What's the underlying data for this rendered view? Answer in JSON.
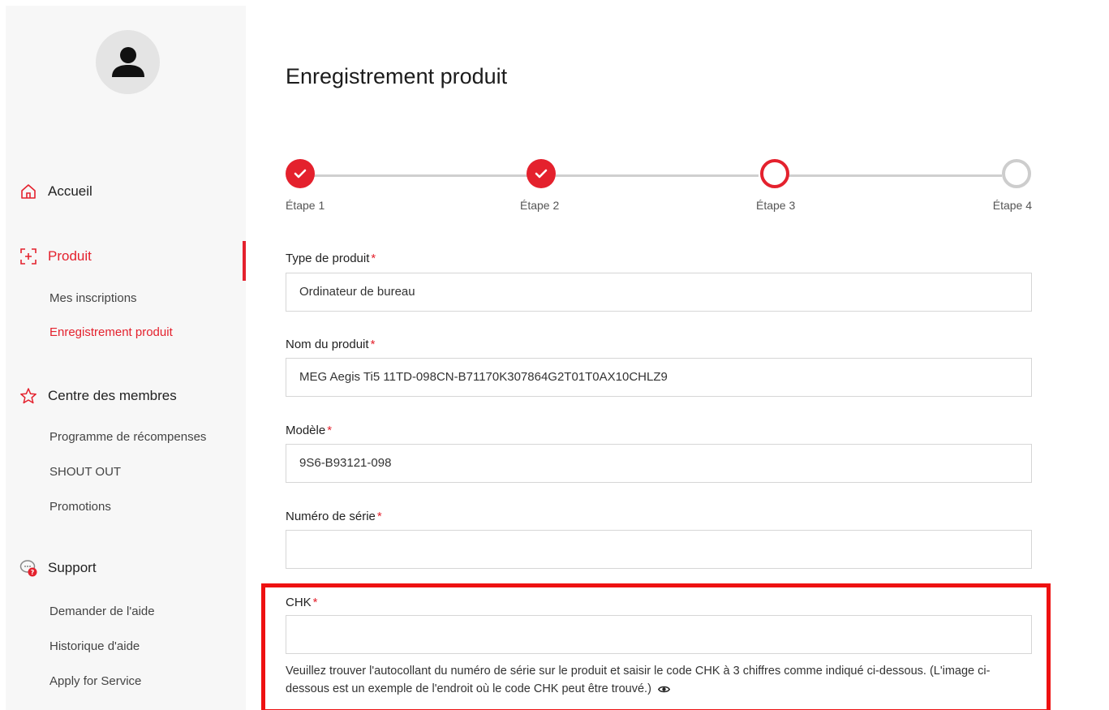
{
  "sidebar": {
    "sections": [
      {
        "label": "Accueil",
        "icon": "home-icon"
      },
      {
        "label": "Produit",
        "icon": "product-icon",
        "active": true
      },
      {
        "label": "Centre des membres",
        "icon": "star-icon"
      },
      {
        "label": "Support",
        "icon": "support-chat-icon"
      }
    ],
    "produit_items": [
      "Mes inscriptions",
      "Enregistrement produit"
    ],
    "membres_items": [
      "Programme de récompenses",
      "SHOUT OUT",
      "Promotions"
    ],
    "support_items": [
      "Demander de l'aide",
      "Historique d'aide",
      "Apply for Service"
    ]
  },
  "main": {
    "title": "Enregistrement produit",
    "steps": [
      {
        "label": "Étape 1",
        "status": "done"
      },
      {
        "label": "Étape 2",
        "status": "done"
      },
      {
        "label": "Étape 3",
        "status": "current"
      },
      {
        "label": "Étape 4",
        "status": "pending"
      }
    ],
    "fields": {
      "type": {
        "label": "Type de produit",
        "value": "Ordinateur de bureau"
      },
      "nom": {
        "label": "Nom du produit",
        "value": "MEG Aegis Ti5 11TD-098CN-B71170K307864G2T01T0AX10CHLZ9"
      },
      "modele": {
        "label": "Modèle",
        "value": "9S6-B93121-098"
      },
      "serie": {
        "label": "Numéro de série",
        "value": ""
      },
      "chk": {
        "label": "CHK",
        "value": ""
      }
    },
    "required_marker": "*",
    "chk_hint": "Veuillez trouver l'autocollant du numéro de série sur le produit et saisir le code CHK à 3 chiffres comme indiqué ci-dessous. (L'image ci-dessous est un exemple de l'endroit où le code CHK peut être trouvé.)"
  },
  "colors": {
    "accent": "#e4212d",
    "highlight": "#ee1111",
    "sidebar_bg": "#f7f7f7"
  }
}
